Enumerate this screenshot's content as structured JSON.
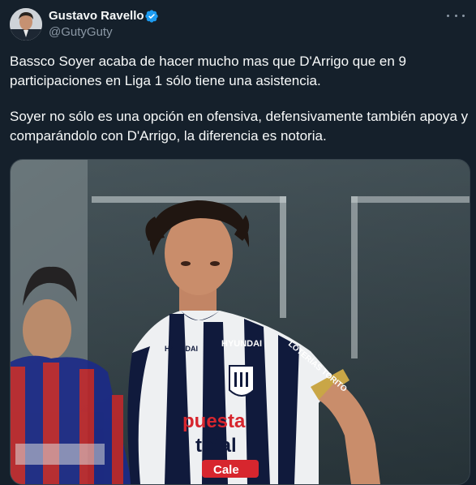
{
  "author": {
    "display_name": "Gustavo Ravello",
    "handle": "@GutyGuty",
    "verified_icon": "verified-badge-icon",
    "avatar_icon": "avatar-photo"
  },
  "tweet": {
    "paragraphs": [
      "Bassco Soyer acaba de hacer mucho mas que D'Arrigo que en 9 participaciones en  Liga 1 sólo tiene una asistencia.",
      "Soyer no sólo es una opción en ofensiva, defensivamente también apoya y comparándolo con D'Arrigo, la diferencia es notoria."
    ]
  },
  "media": {
    "kit_text": {
      "sponsor_left": "HYUNDAI",
      "sponsor_right": "HYUNDAI",
      "sleeve": "LOTERÍAS TORITO",
      "chest_line1": "puesta",
      "chest_line2": "total",
      "chest_line3": "Cale"
    }
  },
  "colors": {
    "background": "#15202b",
    "primary_text": "#f7f9f9",
    "secondary_text": "#8b98a5",
    "verified_blue": "#1d9bf0",
    "sponsor_red": "#d7262e"
  }
}
